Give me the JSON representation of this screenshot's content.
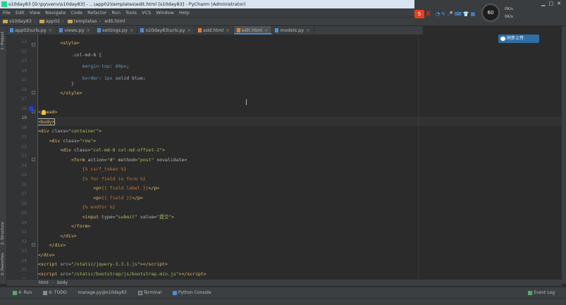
{
  "window": {
    "title": "s10day83 [D:\\py\\venv\\s10day83] - ...\\app02\\templates\\edit.html [s10day83] - PyCharm (Administrator)"
  },
  "menu": [
    "File",
    "Edit",
    "View",
    "Navigate",
    "Code",
    "Refactor",
    "Run",
    "Tools",
    "VCS",
    "Window",
    "Help"
  ],
  "tray": {
    "ime_label": "英",
    "cpu": "60",
    "net_up": "0K/s",
    "net_down": "0K/s"
  },
  "breadcrumb": [
    "s10day83",
    "app02",
    "templates",
    "edit.html"
  ],
  "tabs": [
    {
      "label": "app02\\urls.py",
      "active": false
    },
    {
      "label": "views.py",
      "active": false
    },
    {
      "label": "settings.py",
      "active": false
    },
    {
      "label": "s10day83\\urls.py",
      "active": false
    },
    {
      "label": "add.html",
      "active": false
    },
    {
      "label": "edit.html",
      "active": true
    },
    {
      "label": "models.py",
      "active": false
    }
  ],
  "sync_button": "同步上传",
  "left_tool_windows": [
    "1: Project",
    "2: Structure",
    "2: Favorites"
  ],
  "line_numbers": [
    "11",
    "12",
    "13",
    "14",
    "15",
    "16",
    "17",
    "18",
    "19",
    "20",
    "21",
    "22",
    "23",
    "24",
    "25",
    "26",
    "27",
    "28",
    "29",
    "30",
    "31",
    "32",
    "33",
    "34",
    "35",
    "36"
  ],
  "current_line": "19",
  "code_breadcrumb": [
    "html",
    "body"
  ],
  "bottom_tools": [
    "4: Run",
    "6: TODO",
    "manage.py@s10day83",
    "Terminal",
    "Python Console"
  ],
  "event_log": "Event Log",
  "colors": {
    "background": "#2b2b2b",
    "tag": "#e8bf6a",
    "string": "#a5c25c",
    "number": "#6897bb",
    "keyword": "#cc7832"
  }
}
